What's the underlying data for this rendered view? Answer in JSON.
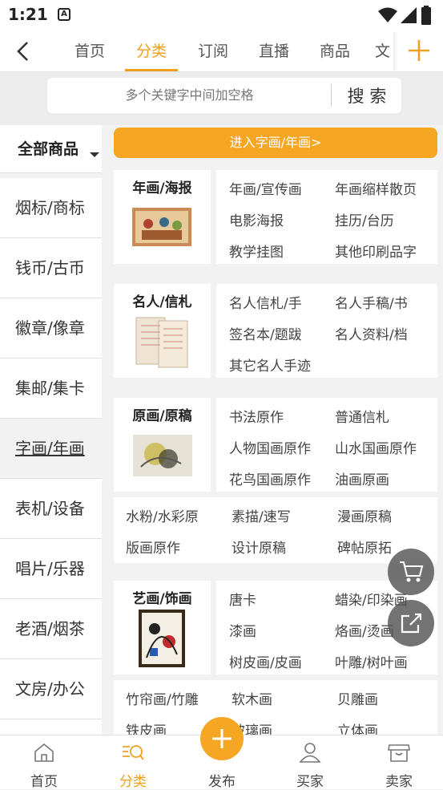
{
  "status_bar": {
    "time": "1:21",
    "sim_badge": "A"
  },
  "topnav": {
    "tabs": [
      {
        "label": "首页"
      },
      {
        "label": "分类"
      },
      {
        "label": "订阅"
      },
      {
        "label": "直播"
      },
      {
        "label": "商品"
      },
      {
        "label": "文"
      }
    ],
    "active_tab": "分类"
  },
  "search": {
    "placeholder": "多个关键字中间加空格",
    "button": "搜 索"
  },
  "sidebar": {
    "all_label": "全部商品",
    "items": [
      {
        "label": "烟标/商标"
      },
      {
        "label": "钱币/古币"
      },
      {
        "label": "徽章/像章"
      },
      {
        "label": "集邮/集卡"
      },
      {
        "label": "字画/年画"
      },
      {
        "label": "表机/设备"
      },
      {
        "label": "唱片/乐器"
      },
      {
        "label": "老酒/烟茶"
      },
      {
        "label": "文房/办公"
      }
    ],
    "active": "字画/年画"
  },
  "enter_banner": "进入字画/年画>",
  "sections": [
    {
      "title": "年画/海报",
      "links": [
        "年画/宣传画",
        "年画缩样散页",
        "电影海报",
        "挂历/台历",
        "教学挂图",
        "其他印刷品字"
      ]
    },
    {
      "title": "名人/信札",
      "links": [
        "名人信札/手",
        "名人手稿/书",
        "签名本/题跋",
        "名人资料/档",
        "其它名人手迹"
      ]
    },
    {
      "title": "原画/原稿",
      "links": [
        "书法原作",
        "普通信札",
        "人物国画原作",
        "山水国画原作",
        "花鸟国画原作",
        "油画原画"
      ],
      "extra": [
        "水粉/水彩原",
        "素描/速写",
        "漫画原稿",
        "版画原作",
        "设计原稿",
        "碑帖原拓"
      ]
    },
    {
      "title": "艺画/饰画",
      "links": [
        "唐卡",
        "蜡染/印染画",
        "漆画",
        "烙画/烫画",
        "树皮画/皮画",
        "叶雕/树叶画"
      ],
      "extra": [
        "竹帘画/竹雕",
        "软木画",
        "贝雕画",
        "铁皮画",
        "玻璃画",
        "立体画"
      ]
    }
  ],
  "bottom_nav": [
    {
      "label": "首页"
    },
    {
      "label": "分类"
    },
    {
      "label": "发布"
    },
    {
      "label": "买家"
    },
    {
      "label": "卖家"
    }
  ],
  "colors": {
    "accent": "#f5a623",
    "active_text": "#f0a020"
  }
}
